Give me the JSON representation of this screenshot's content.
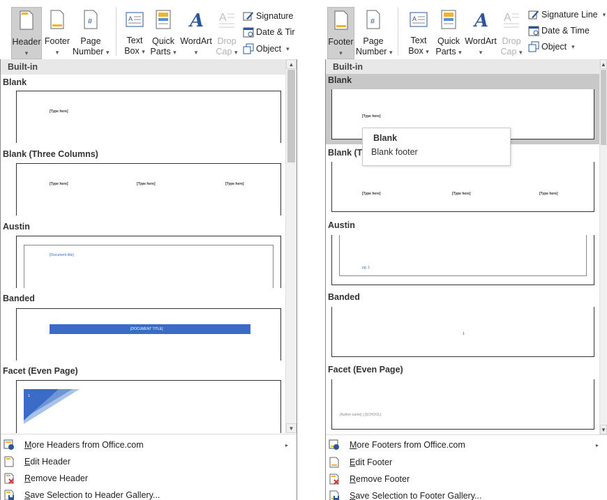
{
  "left": {
    "ribbon": {
      "header": {
        "label": "Header",
        "arrow": "▾"
      },
      "footer": {
        "label": "Footer",
        "arrow": "▾"
      },
      "page_number": {
        "line1": "Page",
        "line2": "Number",
        "arrow": "▾"
      },
      "text_box": {
        "line1": "Text",
        "line2": "Box",
        "arrow": "▾"
      },
      "quick_parts": {
        "line1": "Quick",
        "line2": "Parts",
        "arrow": "▾"
      },
      "wordart": {
        "label": "WordArt",
        "arrow": "▾"
      },
      "drop_cap": {
        "line1": "Drop",
        "line2": "Cap",
        "arrow": "▾"
      },
      "signature": {
        "label": "Signature"
      },
      "date_time": {
        "label": "Date & Tir"
      },
      "object": {
        "label": "Object",
        "arrow": "▾"
      }
    },
    "gallery": {
      "builtin": "Built-in",
      "sections": [
        {
          "name": "Blank",
          "texts": [
            "[Type here]"
          ]
        },
        {
          "name": "Blank (Three Columns)",
          "texts": [
            "[Type here]",
            "[Type here]",
            "[Type here]"
          ]
        },
        {
          "name": "Austin",
          "texts": [
            "[Document title]"
          ]
        },
        {
          "name": "Banded",
          "texts": [
            "[DOCUMENT TITLE]"
          ]
        },
        {
          "name": "Facet (Even Page)",
          "texts": [
            "1"
          ]
        }
      ]
    },
    "menu": [
      {
        "pre": "",
        "key": "M",
        "rest": "ore Headers from Office.com",
        "submenu": "▸"
      },
      {
        "pre": "",
        "key": "E",
        "rest": "dit Header"
      },
      {
        "pre": "",
        "key": "R",
        "rest": "emove Header"
      },
      {
        "pre": "",
        "key": "S",
        "rest": "ave Selection to Header Gallery..."
      }
    ]
  },
  "right": {
    "ribbon": {
      "footer": {
        "label": "Footer",
        "arrow": "▾"
      },
      "page_number": {
        "line1": "Page",
        "line2": "Number",
        "arrow": "▾"
      },
      "text_box": {
        "line1": "Text",
        "line2": "Box",
        "arrow": "▾"
      },
      "quick_parts": {
        "line1": "Quick",
        "line2": "Parts",
        "arrow": "▾"
      },
      "wordart": {
        "label": "WordArt",
        "arrow": "▾"
      },
      "drop_cap": {
        "line1": "Drop",
        "line2": "Cap",
        "arrow": "▾"
      },
      "signature": {
        "label": "Signature Line",
        "arrow": "▾"
      },
      "date_time": {
        "label": "Date & Time"
      },
      "object": {
        "label": "Object",
        "arrow": "▾"
      }
    },
    "gallery": {
      "builtin": "Built-in",
      "sections": [
        {
          "name": "Blank",
          "texts": [
            "[Type here]"
          ]
        },
        {
          "name": "Blank (T",
          "texts": [
            "[Type here]",
            "[Type here]",
            "[Type here]"
          ]
        },
        {
          "name": "Austin",
          "texts": [
            "pg. 1"
          ]
        },
        {
          "name": "Banded",
          "texts": [
            "1"
          ]
        },
        {
          "name": "Facet (Even Page)",
          "texts": [
            "[Author name] | [SCHOOL]"
          ]
        }
      ]
    },
    "tooltip": {
      "title": "Blank",
      "desc": "Blank footer"
    },
    "menu": [
      {
        "pre": "",
        "key": "M",
        "rest": "ore Footers from Office.com",
        "submenu": "▸"
      },
      {
        "pre": "",
        "key": "E",
        "rest": "dit Footer"
      },
      {
        "pre": "",
        "key": "R",
        "rest": "emove Footer"
      },
      {
        "pre": "",
        "key": "S",
        "rest": "ave Selection to Footer Gallery..."
      }
    ]
  },
  "scroll": {
    "up": "▲",
    "down": "▼"
  },
  "colors": {
    "accent_blue": "#3a6bc7",
    "hover_gray": "#c8c8c8",
    "active_btn": "#cfcfcf"
  }
}
